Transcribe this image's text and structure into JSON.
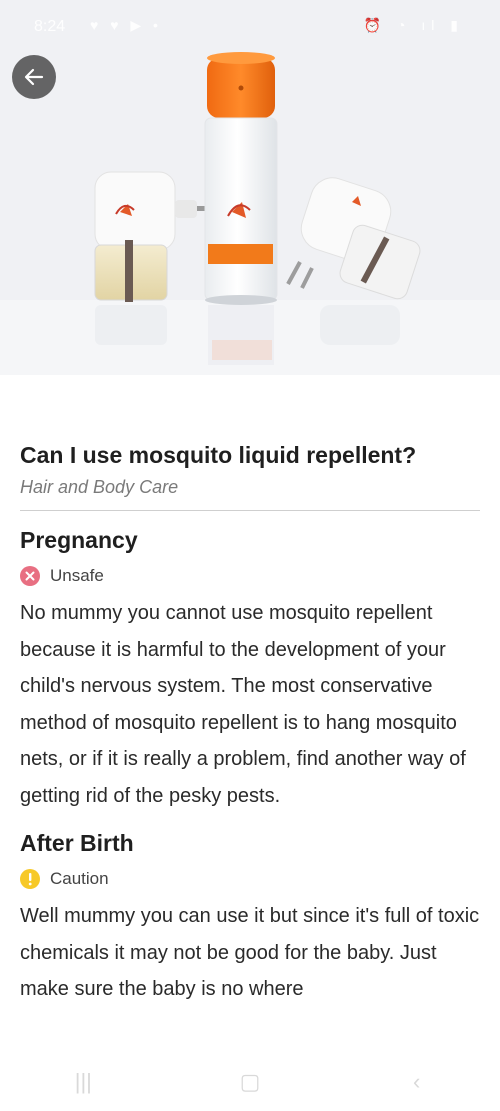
{
  "status_bar": {
    "time": "8:24",
    "left_icons": "♥ ♥ ▶ •",
    "right_icons": "⏰ ◔ ıl ▮"
  },
  "hero": {
    "back_icon": "arrow-left-icon"
  },
  "article": {
    "title": "Can I use mosquito liquid repellent?",
    "category": "Hair and Body Care",
    "sections": [
      {
        "heading": "Pregnancy",
        "status": "Unsafe",
        "status_color": "#e86f82",
        "text": "No mummy you cannot use mosquito repellent because it is harmful to the development of your child's nervous system. The most conservative method of mosquito repellent is to hang mosquito nets, or if it is really a problem, find another way of getting rid of the pesky pests."
      },
      {
        "heading": "After Birth",
        "status": "Caution",
        "status_color": "#f7c928",
        "text": "Well mummy you can use it but since it's full of toxic chemicals it may not be good for the baby. Just make sure the baby is no where"
      }
    ]
  },
  "nav": {
    "recent": "|||",
    "home": "▢",
    "back": "‹"
  }
}
